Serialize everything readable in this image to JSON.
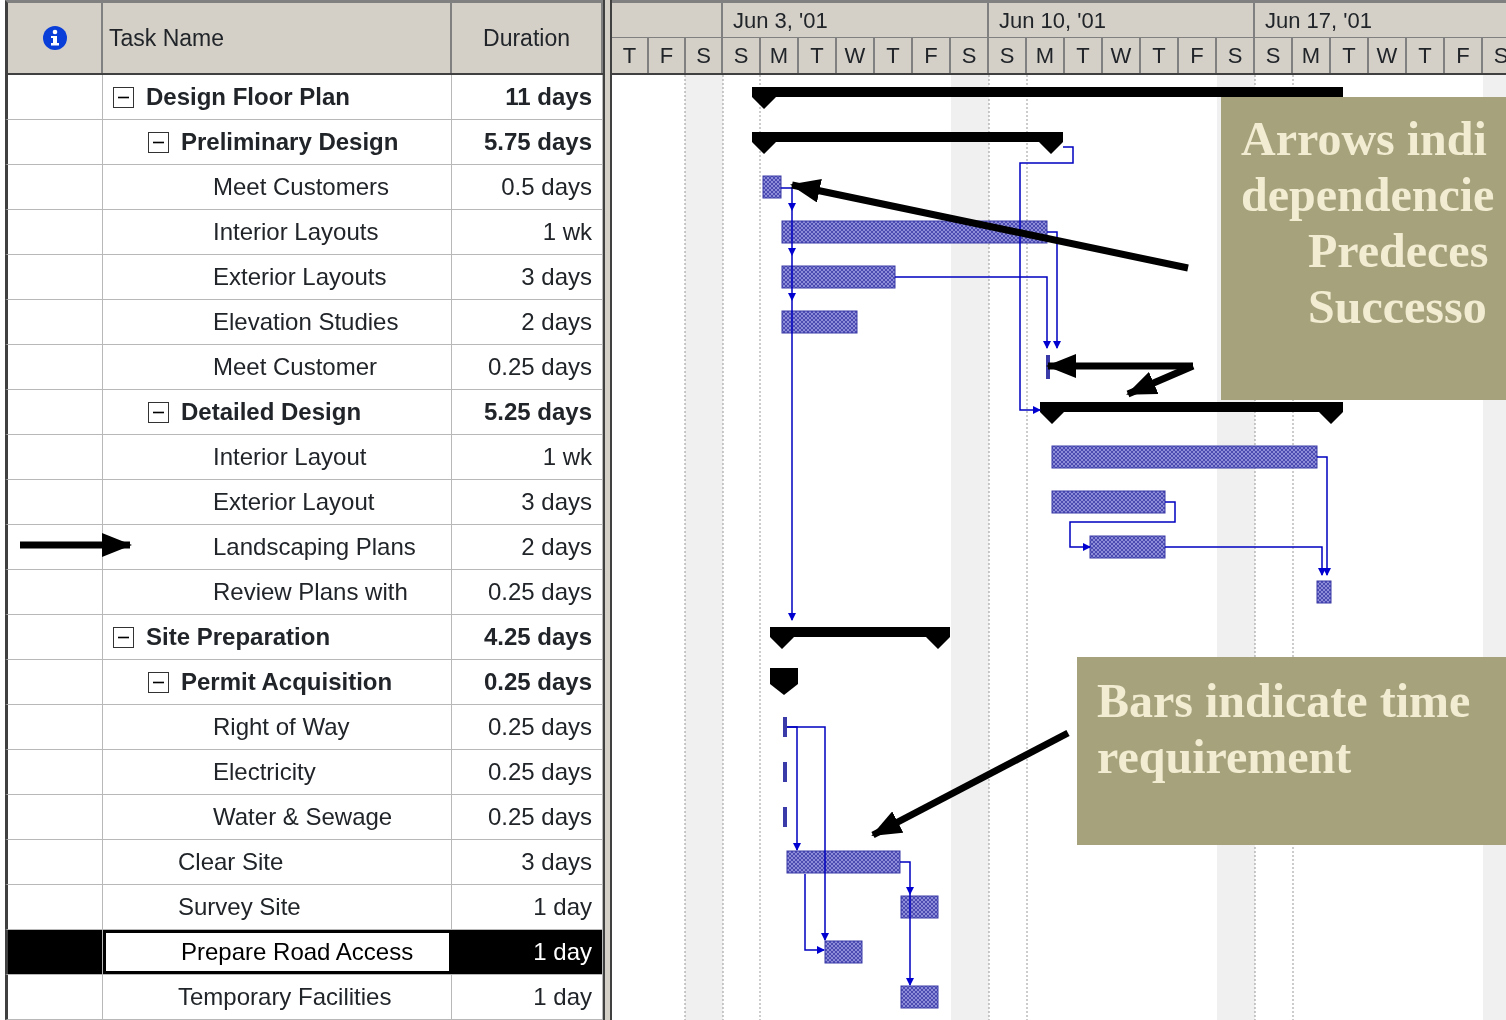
{
  "header": {
    "task_name": "Task Name",
    "duration": "Duration"
  },
  "timescale": {
    "weeks": [
      "Jun 3, '01",
      "Jun 10, '01",
      "Jun 17, '01"
    ],
    "days": [
      "T",
      "F",
      "S",
      "S",
      "M",
      "T",
      "W",
      "T",
      "F",
      "S",
      "S",
      "M",
      "T",
      "W",
      "T",
      "F",
      "S",
      "S",
      "M",
      "T",
      "W",
      "T",
      "F",
      "S"
    ]
  },
  "tasks": [
    {
      "name": "Design Floor Plan",
      "duration": "11 days",
      "expanded": true,
      "selected": false,
      "children": [
        {
          "name": "Preliminary Design",
          "duration": "5.75 days",
          "expanded": true,
          "selected": false,
          "children": [
            {
              "name": "Meet Customers",
              "duration": "0.5 days",
              "selected": false
            },
            {
              "name": "Interior Layouts",
              "duration": "1 wk",
              "selected": false
            },
            {
              "name": "Exterior Layouts",
              "duration": "3 days",
              "selected": false
            },
            {
              "name": "Elevation Studies",
              "duration": "2 days",
              "selected": false
            },
            {
              "name": "Meet Customer",
              "duration": "0.25 days",
              "selected": false
            }
          ]
        },
        {
          "name": "Detailed Design",
          "duration": "5.25 days",
          "expanded": true,
          "selected": false,
          "children": [
            {
              "name": "Interior Layout",
              "duration": "1 wk",
              "selected": false
            },
            {
              "name": "Exterior Layout",
              "duration": "3 days",
              "selected": false
            },
            {
              "name": "Landscaping Plans",
              "duration": "2 days",
              "selected": false
            },
            {
              "name": "Review Plans with",
              "duration": "0.25 days",
              "selected": false
            }
          ]
        }
      ]
    },
    {
      "name": "Site Preparation",
      "duration": "4.25 days",
      "expanded": true,
      "selected": false,
      "children": [
        {
          "name": "Permit Acquisition",
          "duration": "0.25 days",
          "expanded": true,
          "selected": false,
          "children": [
            {
              "name": "Right of Way",
              "duration": "0.25 days",
              "selected": false
            },
            {
              "name": "Electricity",
              "duration": "0.25 days",
              "selected": false
            },
            {
              "name": "Water & Sewage",
              "duration": "0.25 days",
              "selected": false
            }
          ]
        },
        {
          "name": "Clear Site",
          "duration": "3 days",
          "selected": false
        },
        {
          "name": "Survey Site",
          "duration": "1 day",
          "selected": false
        },
        {
          "name": "Prepare Road Access",
          "duration": "1 day",
          "selected": true
        },
        {
          "name": "Temporary Facilities",
          "duration": "1 day",
          "selected": false
        }
      ]
    }
  ],
  "callouts": [
    {
      "lines": [
        {
          "text": "Arrows indi",
          "indented": false
        },
        {
          "text": "dependencie",
          "indented": false
        },
        {
          "text": "Predeces",
          "indented": true
        },
        {
          "text": "Successo",
          "indented": true
        }
      ]
    },
    {
      "lines": [
        {
          "text": "Bars indicate time",
          "indented": false
        },
        {
          "text": "requirement",
          "indented": false
        }
      ]
    }
  ]
}
